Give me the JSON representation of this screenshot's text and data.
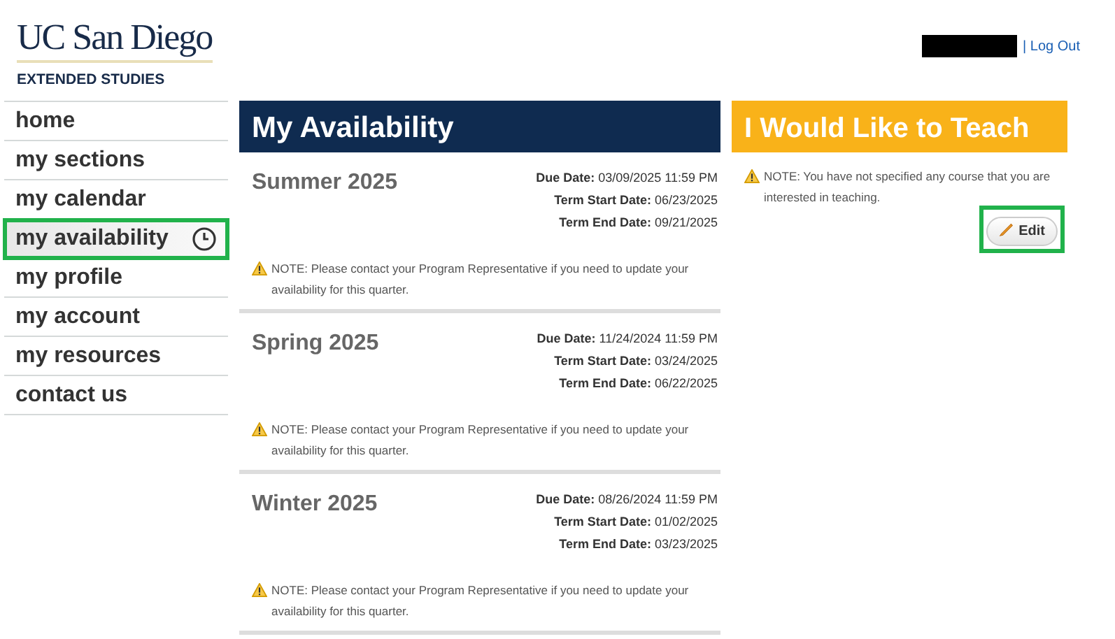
{
  "logo": {
    "wordmark": "UC San Diego",
    "subtitle": "EXTENDED STUDIES"
  },
  "header": {
    "logout": "| Log Out"
  },
  "sidebar": {
    "items": [
      {
        "label": "home",
        "selected": false,
        "highlighted": false
      },
      {
        "label": "my sections",
        "selected": false,
        "highlighted": false
      },
      {
        "label": "my calendar",
        "selected": false,
        "highlighted": false
      },
      {
        "label": "my availability",
        "selected": true,
        "highlighted": true
      },
      {
        "label": "my profile",
        "selected": false,
        "highlighted": false
      },
      {
        "label": "my account",
        "selected": false,
        "highlighted": false
      },
      {
        "label": "my resources",
        "selected": false,
        "highlighted": false
      },
      {
        "label": "contact us",
        "selected": false,
        "highlighted": false
      }
    ]
  },
  "availability": {
    "title": "My Availability",
    "terms": [
      {
        "name": "Summer 2025",
        "dates": [
          "**Due Date:** 03/09/2025 11:59 PM",
          "**Term Start Date:** 06/23/2025",
          "**Term End Date:** 09/21/2025"
        ],
        "note": "NOTE: Please contact your Program Representative if you need to update your availability for this quarter."
      },
      {
        "name": "Spring 2025",
        "dates": [
          "**Due Date:** 11/24/2024 11:59 PM",
          "**Term Start Date:** 03/24/2025",
          "**Term End Date:** 06/22/2025"
        ],
        "note": "NOTE: Please contact your Program Representative if you need to update your availability for this quarter."
      },
      {
        "name": "Winter 2025",
        "dates": [
          "**Due Date:** 08/26/2024 11:59 PM",
          "**Term Start Date:** 01/02/2025",
          "**Term End Date:** 03/23/2025"
        ],
        "note": "NOTE: Please contact your Program Representative if you need to update your availability for this quarter."
      }
    ]
  },
  "teach": {
    "title": "I Would Like to Teach",
    "note": "NOTE: You have not specified any course that you are interested in teaching.",
    "edit_button": {
      "label": "Edit",
      "highlighted": true
    }
  }
}
